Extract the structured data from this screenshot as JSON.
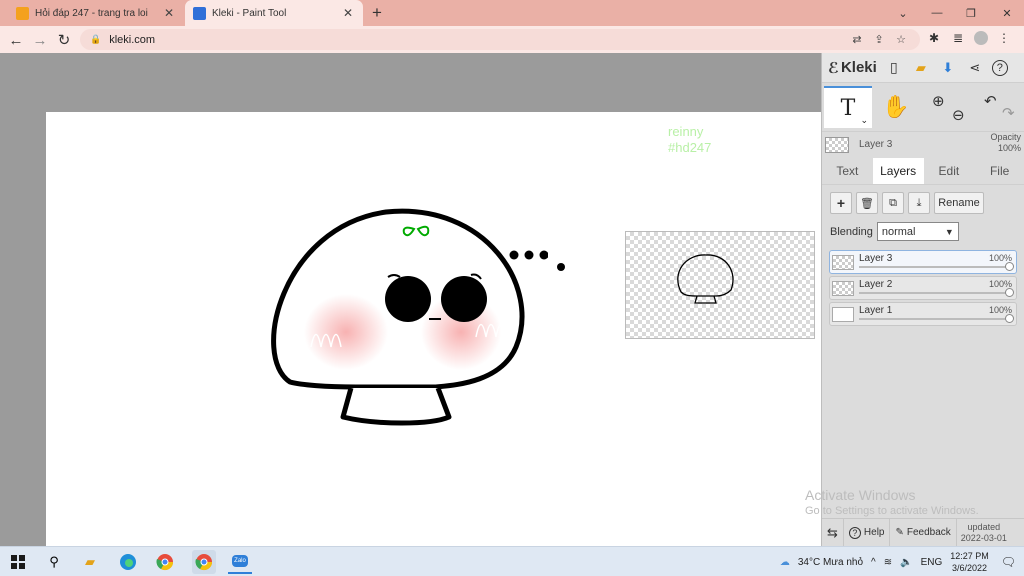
{
  "browser": {
    "tabs": [
      {
        "title": "Hỏi đáp 247 - trang tra loi",
        "favicon_color": "#f4a11d"
      },
      {
        "title": "Kleki - Paint Tool",
        "favicon_color": "#2f6fd8"
      }
    ],
    "url": "kleki.com"
  },
  "canvas": {
    "signature_line1": "reinny",
    "signature_line2": "#hd247"
  },
  "kleki": {
    "logo": "Kleki",
    "text_tool": "T",
    "current_layer": {
      "name": "Layer 3",
      "opacity_label": "Opacity",
      "opacity_value": "100%"
    },
    "tabs": [
      "Text",
      "Layers",
      "Edit",
      "File"
    ],
    "active_tab": "Layers",
    "rename_label": "Rename",
    "blending_label": "Blending",
    "blending_value": "normal",
    "layers": [
      {
        "name": "Layer 3",
        "opacity": "100%"
      },
      {
        "name": "Layer 2",
        "opacity": "100%"
      },
      {
        "name": "Layer 1",
        "opacity": "100%"
      }
    ],
    "footer": {
      "help": "Help",
      "feedback": "Feedback",
      "updated_label": "updated",
      "updated_date": "2022-03-01"
    }
  },
  "watermark": {
    "line1": "Activate Windows",
    "line2": "Go to Settings to activate Windows."
  },
  "taskbar": {
    "weather": "34°C  Mưa nhỏ",
    "lang": "ENG",
    "time": "12:27 PM",
    "date": "3/6/2022",
    "zalo": "Zalo"
  },
  "colors": {
    "accent": "#4a90d9",
    "tabbar": "#eab0a6",
    "signature": "#b9f0a7"
  }
}
